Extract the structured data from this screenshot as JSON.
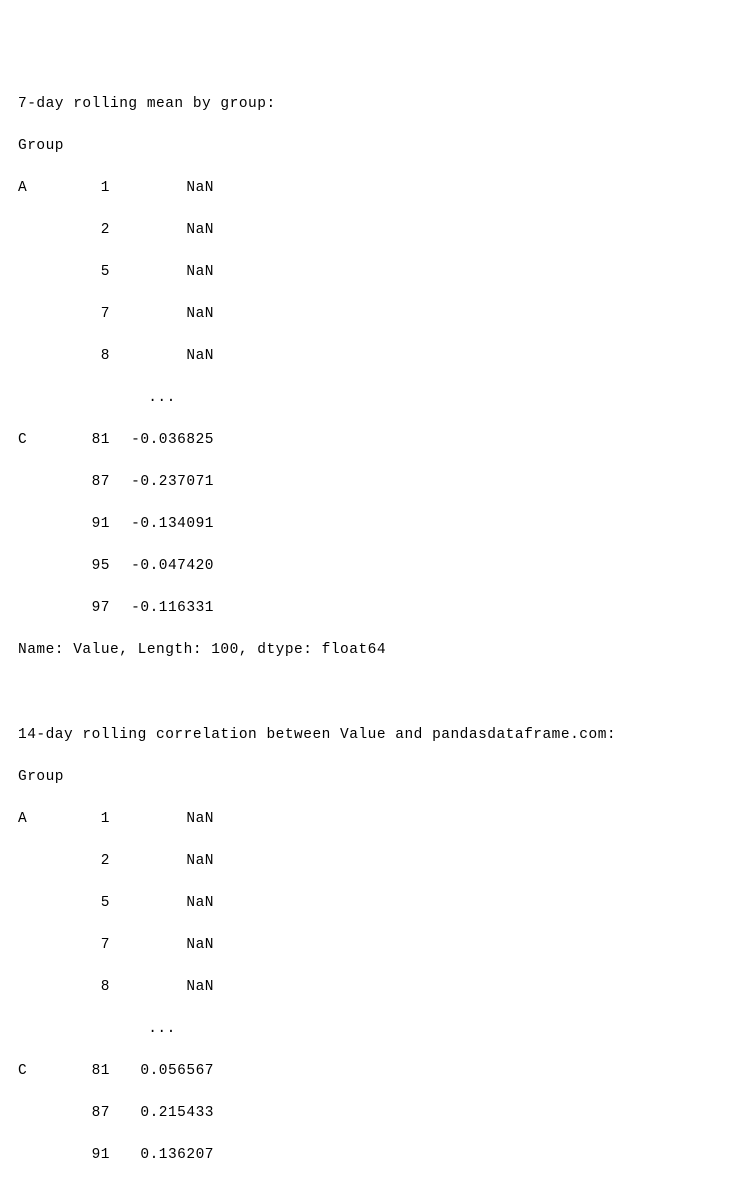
{
  "section1": {
    "title": "7-day rolling mean by group:",
    "header": "Group",
    "top_group": "A",
    "rows_top": [
      {
        "idx": "1",
        "val": "NaN"
      },
      {
        "idx": "2",
        "val": "NaN"
      },
      {
        "idx": "5",
        "val": "NaN"
      },
      {
        "idx": "7",
        "val": "NaN"
      },
      {
        "idx": "8",
        "val": "NaN"
      }
    ],
    "ellipsis": "...",
    "bottom_group": "C",
    "rows_bottom": [
      {
        "idx": "81",
        "val": "-0.036825"
      },
      {
        "idx": "87",
        "val": "-0.237071"
      },
      {
        "idx": "91",
        "val": "-0.134091"
      },
      {
        "idx": "95",
        "val": "-0.047420"
      },
      {
        "idx": "97",
        "val": "-0.116331"
      }
    ],
    "footer": "Name: Value, Length: 100, dtype: float64"
  },
  "section2": {
    "title": "14-day rolling correlation between Value and pandasdataframe.com:",
    "header": "Group",
    "top_group": "A",
    "rows_top": [
      {
        "idx": "1",
        "val": "NaN"
      },
      {
        "idx": "2",
        "val": "NaN"
      },
      {
        "idx": "5",
        "val": "NaN"
      },
      {
        "idx": "7",
        "val": "NaN"
      },
      {
        "idx": "8",
        "val": "NaN"
      }
    ],
    "ellipsis": "...",
    "bottom_group": "C",
    "rows_bottom": [
      {
        "idx": "81",
        "val": "0.056567"
      },
      {
        "idx": "87",
        "val": "0.215433"
      },
      {
        "idx": "91",
        "val": "0.136207"
      }
    ]
  },
  "chart_data": {
    "type": "table",
    "title": "Pandas console output — rolling window stats by group (truncated)",
    "blocks": [
      {
        "name": "7-day rolling mean by group",
        "index_name": "Group",
        "series_name": "Value",
        "length": 100,
        "dtype": "float64",
        "rows_shown": [
          {
            "Group": "A",
            "index": 1,
            "value": null
          },
          {
            "Group": "A",
            "index": 2,
            "value": null
          },
          {
            "Group": "A",
            "index": 5,
            "value": null
          },
          {
            "Group": "A",
            "index": 7,
            "value": null
          },
          {
            "Group": "A",
            "index": 8,
            "value": null
          },
          {
            "Group": "C",
            "index": 81,
            "value": -0.036825
          },
          {
            "Group": "C",
            "index": 87,
            "value": -0.237071
          },
          {
            "Group": "C",
            "index": 91,
            "value": -0.134091
          },
          {
            "Group": "C",
            "index": 95,
            "value": -0.04742
          },
          {
            "Group": "C",
            "index": 97,
            "value": -0.116331
          }
        ]
      },
      {
        "name": "14-day rolling correlation between Value and pandasdataframe.com",
        "index_name": "Group",
        "rows_shown": [
          {
            "Group": "A",
            "index": 1,
            "value": null
          },
          {
            "Group": "A",
            "index": 2,
            "value": null
          },
          {
            "Group": "A",
            "index": 5,
            "value": null
          },
          {
            "Group": "A",
            "index": 7,
            "value": null
          },
          {
            "Group": "A",
            "index": 8,
            "value": null
          },
          {
            "Group": "C",
            "index": 81,
            "value": 0.056567
          },
          {
            "Group": "C",
            "index": 87,
            "value": 0.215433
          },
          {
            "Group": "C",
            "index": 91,
            "value": 0.136207
          }
        ]
      }
    ]
  }
}
